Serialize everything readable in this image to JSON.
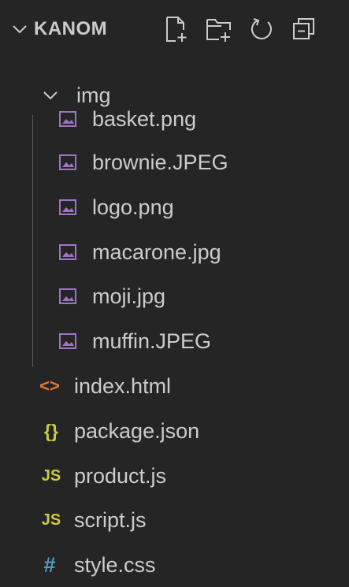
{
  "explorer": {
    "folder_name": "KANOM",
    "actions": [
      {
        "name": "new-file-icon"
      },
      {
        "name": "new-folder-icon"
      },
      {
        "name": "refresh-icon"
      },
      {
        "name": "collapse-all-icon"
      }
    ]
  },
  "tree": {
    "img_folder": {
      "label": "img",
      "expanded": true
    },
    "img_files": [
      {
        "label": "basket.png",
        "icon": "image-file-icon"
      },
      {
        "label": "brownie.JPEG",
        "icon": "image-file-icon"
      },
      {
        "label": "logo.png",
        "icon": "image-file-icon"
      },
      {
        "label": "macarone.jpg",
        "icon": "image-file-icon"
      },
      {
        "label": "moji.jpg",
        "icon": "image-file-icon"
      },
      {
        "label": "muffin.JPEG",
        "icon": "image-file-icon"
      }
    ],
    "root_files": [
      {
        "label": "index.html",
        "icon": "html-file-icon",
        "glyph": "<>"
      },
      {
        "label": "package.json",
        "icon": "json-file-icon",
        "glyph": "{}"
      },
      {
        "label": "product.js",
        "icon": "js-file-icon",
        "glyph": "JS"
      },
      {
        "label": "script.js",
        "icon": "js-file-icon",
        "glyph": "JS"
      },
      {
        "label": "style.css",
        "icon": "css-file-icon",
        "glyph": "#"
      }
    ]
  },
  "colors": {
    "background": "#252526",
    "text": "#cccccc",
    "image_icon": "#a074c4",
    "html_icon": "#e37933",
    "json_icon": "#cbcb41",
    "js_icon": "#cbcb41",
    "css_icon": "#519aba"
  }
}
